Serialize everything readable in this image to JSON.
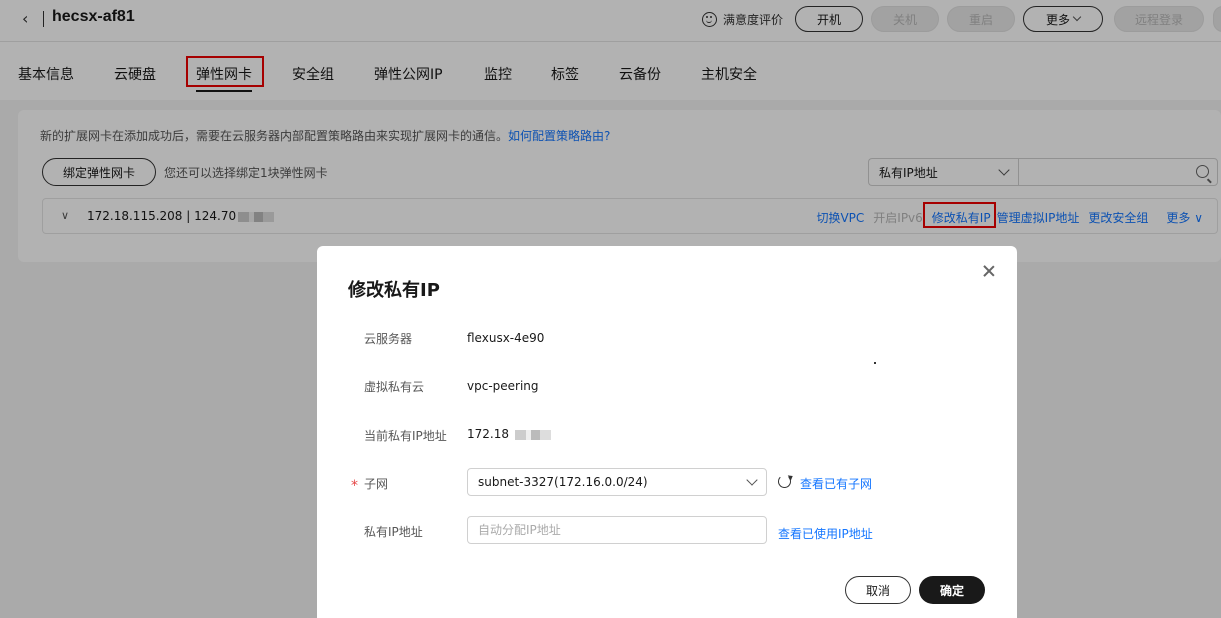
{
  "header": {
    "back_icon": "chevron-left-icon",
    "title": "hecsx-af81",
    "satisfaction_label": "满意度评价",
    "buttons": {
      "start": "开机",
      "shutdown": "关机",
      "restart": "重启",
      "more": "更多",
      "remote_login": "远程登录"
    }
  },
  "tabs": [
    "基本信息",
    "云硬盘",
    "弹性网卡",
    "安全组",
    "弹性公网IP",
    "监控",
    "标签",
    "云备份",
    "主机安全"
  ],
  "active_tab": "弹性网卡",
  "nic_panel": {
    "tip_text": "新的扩展网卡在添加成功后，需要在云服务器内部配置策略路由来实现扩展网卡的通信。",
    "tip_link": "如何配置策略路由?",
    "bind_button": "绑定弹性网卡",
    "bind_hint": "您还可以选择绑定1块弹性网卡",
    "filter_select": "私有IP地址",
    "nic_ip": "172.18.115.208 | 124.70",
    "actions": {
      "switch_vpc": "切换VPC",
      "enable_ipv6": "开启IPv6",
      "modify_private_ip": "修改私有IP",
      "manage_virtual_ip": "管理虚拟IP地址",
      "change_security_group": "更改安全组",
      "more": "更多"
    }
  },
  "dialog": {
    "title": "修改私有IP",
    "fields": {
      "server_label": "云服务器",
      "server_value": "flexusx-4e90",
      "vpc_label": "虚拟私有云",
      "vpc_value": "vpc-peering",
      "current_ip_label": "当前私有IP地址",
      "current_ip_value": "172.18",
      "subnet_label": "子网",
      "subnet_value": "subnet-3327(172.16.0.0/24)",
      "subnet_link": "查看已有子网",
      "private_ip_label": "私有IP地址",
      "private_ip_placeholder": "自动分配IP地址",
      "private_ip_link": "查看已使用IP地址"
    },
    "cancel_label": "取消",
    "ok_label": "确定"
  },
  "colors": {
    "link": "#1476ff",
    "highlight_box": "#ee0000",
    "primary_button": "#191919",
    "required": "#e54545"
  }
}
